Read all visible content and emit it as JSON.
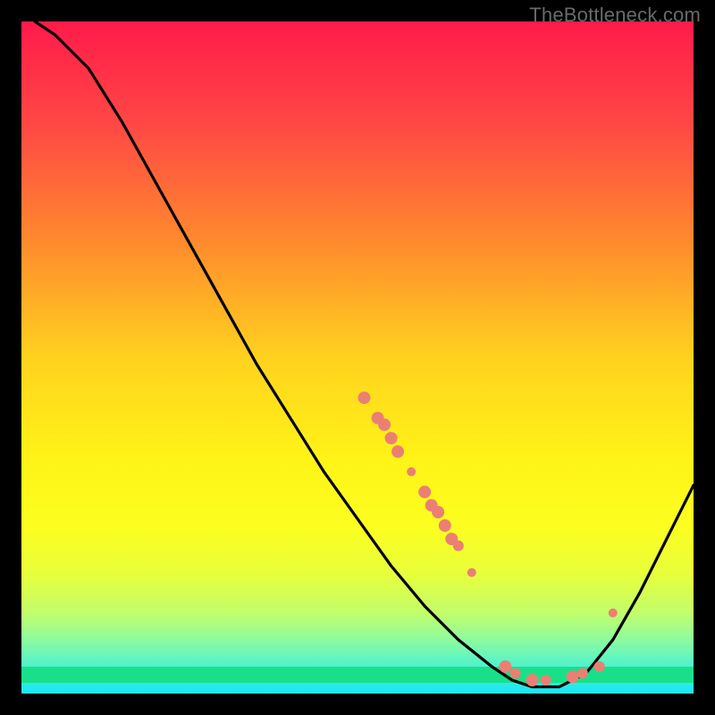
{
  "watermark": "TheBottleneck.com",
  "chart_data": {
    "type": "line",
    "title": "",
    "xlabel": "",
    "ylabel": "",
    "xlim": [
      0,
      100
    ],
    "ylim": [
      0,
      100
    ],
    "background": "rainbow-vertical-gradient",
    "curve": [
      {
        "x": 2,
        "y": 100
      },
      {
        "x": 5,
        "y": 98
      },
      {
        "x": 10,
        "y": 93
      },
      {
        "x": 15,
        "y": 85
      },
      {
        "x": 20,
        "y": 76
      },
      {
        "x": 25,
        "y": 67
      },
      {
        "x": 30,
        "y": 58
      },
      {
        "x": 35,
        "y": 49
      },
      {
        "x": 40,
        "y": 41
      },
      {
        "x": 45,
        "y": 33
      },
      {
        "x": 50,
        "y": 26
      },
      {
        "x": 55,
        "y": 19
      },
      {
        "x": 60,
        "y": 13
      },
      {
        "x": 65,
        "y": 8
      },
      {
        "x": 70,
        "y": 4
      },
      {
        "x": 73,
        "y": 2
      },
      {
        "x": 76,
        "y": 1
      },
      {
        "x": 80,
        "y": 1
      },
      {
        "x": 84,
        "y": 3
      },
      {
        "x": 88,
        "y": 8
      },
      {
        "x": 92,
        "y": 15
      },
      {
        "x": 96,
        "y": 23
      },
      {
        "x": 100,
        "y": 31
      }
    ],
    "markers": [
      {
        "x": 51,
        "y": 44,
        "r": 7
      },
      {
        "x": 53,
        "y": 41,
        "r": 7
      },
      {
        "x": 54,
        "y": 40,
        "r": 7
      },
      {
        "x": 55,
        "y": 38,
        "r": 7
      },
      {
        "x": 56,
        "y": 36,
        "r": 7
      },
      {
        "x": 58,
        "y": 33,
        "r": 5
      },
      {
        "x": 60,
        "y": 30,
        "r": 7
      },
      {
        "x": 61,
        "y": 28,
        "r": 7
      },
      {
        "x": 62,
        "y": 27,
        "r": 7
      },
      {
        "x": 63,
        "y": 25,
        "r": 7
      },
      {
        "x": 64,
        "y": 23,
        "r": 7
      },
      {
        "x": 65,
        "y": 22,
        "r": 6
      },
      {
        "x": 67,
        "y": 18,
        "r": 5
      },
      {
        "x": 72,
        "y": 4,
        "r": 7
      },
      {
        "x": 73.5,
        "y": 3,
        "r": 6
      },
      {
        "x": 76,
        "y": 2,
        "r": 7
      },
      {
        "x": 78,
        "y": 2,
        "r": 6
      },
      {
        "x": 82,
        "y": 2.5,
        "r": 7
      },
      {
        "x": 83.5,
        "y": 3,
        "r": 6
      },
      {
        "x": 86,
        "y": 4,
        "r": 6
      },
      {
        "x": 88,
        "y": 12,
        "r": 5
      }
    ],
    "marker_color": "#eb7f74",
    "curve_color": "#000000",
    "gradient_stops": [
      {
        "offset": 0.0,
        "color": "#ff1a4a"
      },
      {
        "offset": 0.16,
        "color": "#ff4a44"
      },
      {
        "offset": 0.33,
        "color": "#ff8b2d"
      },
      {
        "offset": 0.5,
        "color": "#ffd21e"
      },
      {
        "offset": 0.65,
        "color": "#fff317"
      },
      {
        "offset": 0.75,
        "color": "#fcfe1f"
      },
      {
        "offset": 0.82,
        "color": "#e8ff3a"
      },
      {
        "offset": 0.88,
        "color": "#c2fe6a"
      },
      {
        "offset": 0.92,
        "color": "#8dfb9e"
      },
      {
        "offset": 0.96,
        "color": "#4ef2cf"
      },
      {
        "offset": 1.0,
        "color": "#18e6f6"
      }
    ]
  }
}
